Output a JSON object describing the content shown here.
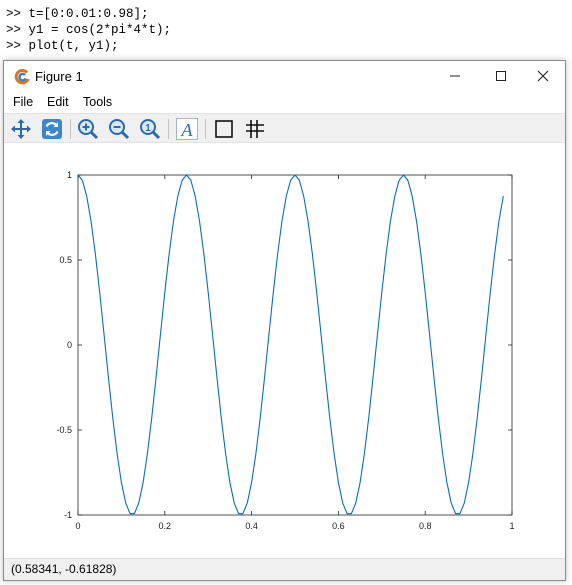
{
  "console": {
    "lines": [
      ">> t=[0:0.01:0.98];",
      ">> y1 = cos(2*pi*4*t);",
      ">> plot(t, y1);"
    ]
  },
  "window": {
    "title": "Figure 1",
    "icon": "octave-logo-icon",
    "buttons": {
      "minimize": "minimize-icon",
      "maximize": "maximize-icon",
      "close": "close-icon"
    }
  },
  "menu": {
    "file": "File",
    "edit": "Edit",
    "tools": "Tools"
  },
  "toolbar": {
    "tools": [
      "pan-icon",
      "rotate-icon",
      "zoom-in-icon",
      "zoom-out-icon",
      "zoom-reset-icon",
      "text-icon",
      "axes-box-icon",
      "grid-icon"
    ],
    "text_tool_label": "A",
    "zoom_reset_label": "1"
  },
  "status": {
    "coordinates": "(0.58341, -0.61828)"
  },
  "colors": {
    "line": "#0072bd",
    "toolbar_bg": "#f0f0f0",
    "status_bg": "#f0f0f0"
  },
  "chart_data": {
    "type": "line",
    "title": "",
    "xlabel": "",
    "ylabel": "",
    "xlim": [
      0,
      1
    ],
    "ylim": [
      -1,
      1
    ],
    "grid": false,
    "x_ticks": [
      "0",
      "0.2",
      "0.4",
      "0.6",
      "0.8",
      "1"
    ],
    "y_ticks": [
      "1",
      "0.5",
      "0",
      "-0.5",
      "-1"
    ],
    "series": [
      {
        "x": [
          0.0,
          0.01,
          0.02,
          0.03,
          0.04,
          0.05,
          0.06,
          0.07,
          0.08,
          0.09,
          0.1,
          0.11,
          0.12,
          0.13,
          0.14,
          0.15,
          0.16,
          0.17,
          0.18,
          0.19,
          0.2,
          0.21,
          0.22,
          0.23,
          0.24,
          0.25,
          0.26,
          0.27,
          0.28,
          0.29,
          0.3,
          0.31,
          0.32,
          0.33,
          0.34,
          0.35,
          0.36,
          0.37,
          0.38,
          0.39,
          0.4,
          0.41,
          0.42,
          0.43,
          0.44,
          0.45,
          0.46,
          0.47,
          0.48,
          0.49,
          0.5,
          0.51,
          0.52,
          0.53,
          0.54,
          0.55,
          0.56,
          0.57,
          0.58,
          0.59,
          0.6,
          0.61,
          0.62,
          0.63,
          0.64,
          0.65,
          0.66,
          0.67,
          0.68,
          0.69,
          0.7,
          0.71,
          0.72,
          0.73,
          0.74,
          0.75,
          0.76,
          0.77,
          0.78,
          0.79,
          0.8,
          0.81,
          0.82,
          0.83,
          0.84,
          0.85,
          0.86,
          0.87,
          0.88,
          0.89,
          0.9,
          0.91,
          0.92,
          0.93,
          0.94,
          0.95,
          0.96,
          0.97,
          0.98
        ],
        "y": [
          1.0,
          0.969,
          0.876,
          0.729,
          0.536,
          0.309,
          0.063,
          -0.187,
          -0.426,
          -0.637,
          -0.809,
          -0.93,
          -0.992,
          -0.992,
          -0.93,
          -0.809,
          -0.637,
          -0.426,
          -0.187,
          0.063,
          0.309,
          0.536,
          0.729,
          0.876,
          0.969,
          1.0,
          0.969,
          0.876,
          0.729,
          0.536,
          0.309,
          0.063,
          -0.187,
          -0.426,
          -0.637,
          -0.809,
          -0.93,
          -0.992,
          -0.992,
          -0.93,
          -0.809,
          -0.637,
          -0.426,
          -0.187,
          0.063,
          0.309,
          0.536,
          0.729,
          0.876,
          0.969,
          1.0,
          0.969,
          0.876,
          0.729,
          0.536,
          0.309,
          0.063,
          -0.187,
          -0.426,
          -0.637,
          -0.809,
          -0.93,
          -0.992,
          -0.992,
          -0.93,
          -0.809,
          -0.637,
          -0.426,
          -0.187,
          0.063,
          0.309,
          0.536,
          0.729,
          0.876,
          0.969,
          1.0,
          0.969,
          0.876,
          0.729,
          0.536,
          0.309,
          0.063,
          -0.187,
          -0.426,
          -0.637,
          -0.809,
          -0.93,
          -0.992,
          -0.992,
          -0.93,
          -0.809,
          -0.637,
          -0.426,
          -0.187,
          0.063,
          0.309,
          0.536,
          0.729,
          0.876
        ]
      }
    ]
  }
}
